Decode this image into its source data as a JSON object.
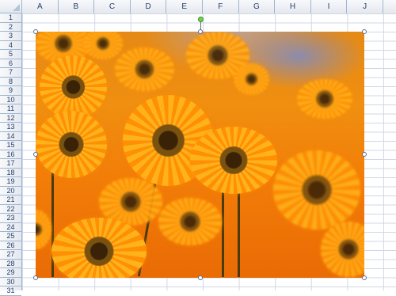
{
  "spreadsheet": {
    "columns": [
      "A",
      "B",
      "C",
      "D",
      "E",
      "F",
      "G",
      "H",
      "I",
      "J"
    ],
    "rows": [
      "1",
      "2",
      "3",
      "4",
      "5",
      "6",
      "7",
      "8",
      "9",
      "10",
      "11",
      "12",
      "13",
      "14",
      "15",
      "16",
      "17",
      "18",
      "19",
      "20",
      "21",
      "22",
      "23",
      "24",
      "25",
      "26",
      "27",
      "28",
      "29",
      "30",
      "31"
    ]
  },
  "picture": {
    "description_icon": "flower-photo"
  },
  "colors": {
    "grid_line": "#d0d7e5",
    "header_text": "#27416b",
    "rotate_handle": "#6fd54a"
  }
}
